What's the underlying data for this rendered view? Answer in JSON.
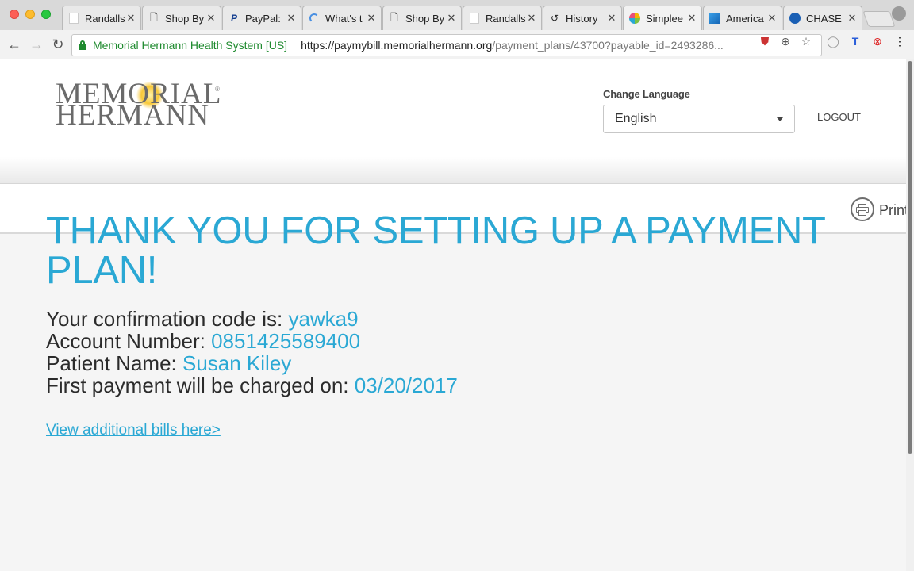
{
  "browser": {
    "tabs": [
      {
        "label": "Randalls",
        "favicon": "blank-page-icon"
      },
      {
        "label": "Shop By",
        "favicon": "document-icon"
      },
      {
        "label": "PayPal:",
        "favicon": "paypal-icon"
      },
      {
        "label": "What's t",
        "favicon": "loading-spinner-icon"
      },
      {
        "label": "Shop By",
        "favicon": "document-icon"
      },
      {
        "label": "Randalls",
        "favicon": "blank-page-icon"
      },
      {
        "label": "History",
        "favicon": "history-icon"
      },
      {
        "label": "Simplee",
        "favicon": "simplee-icon",
        "active": true
      },
      {
        "label": "America",
        "favicon": "americas-icon"
      },
      {
        "label": "CHASE",
        "favicon": "chase-icon"
      }
    ],
    "address": {
      "site_name": "Memorial Hermann Health System [US]",
      "url_host": "https://paymybill.memorialhermann.org",
      "url_path": "/payment_plans/43700?payable_id=2493286..."
    }
  },
  "header": {
    "logo_line1": "MEMORIAL",
    "logo_line2": "HERMANN",
    "logo_reg": "®",
    "change_language_label": "Change Language",
    "language_selected": "English",
    "logout_label": "LOGOUT"
  },
  "printbar": {
    "print_label": "Print"
  },
  "confirmation": {
    "headline_line1": "THANK YOU FOR SETTING UP A PAYMENT",
    "headline_line2": "PLAN!",
    "code_label": "Your confirmation code is: ",
    "code_value": "yawka9",
    "account_label": "Account Number: ",
    "account_value": "0851425589400",
    "patient_label": "Patient Name: ",
    "patient_value": "Susan Kiley",
    "first_payment_label": "First payment will be charged on: ",
    "first_payment_value": "03/20/2017",
    "additional_bills_link": "View additional bills here>"
  },
  "colors": {
    "accent": "#2aa8d4",
    "text": "#2b2b2b",
    "ev_green": "#1e8a2e"
  }
}
